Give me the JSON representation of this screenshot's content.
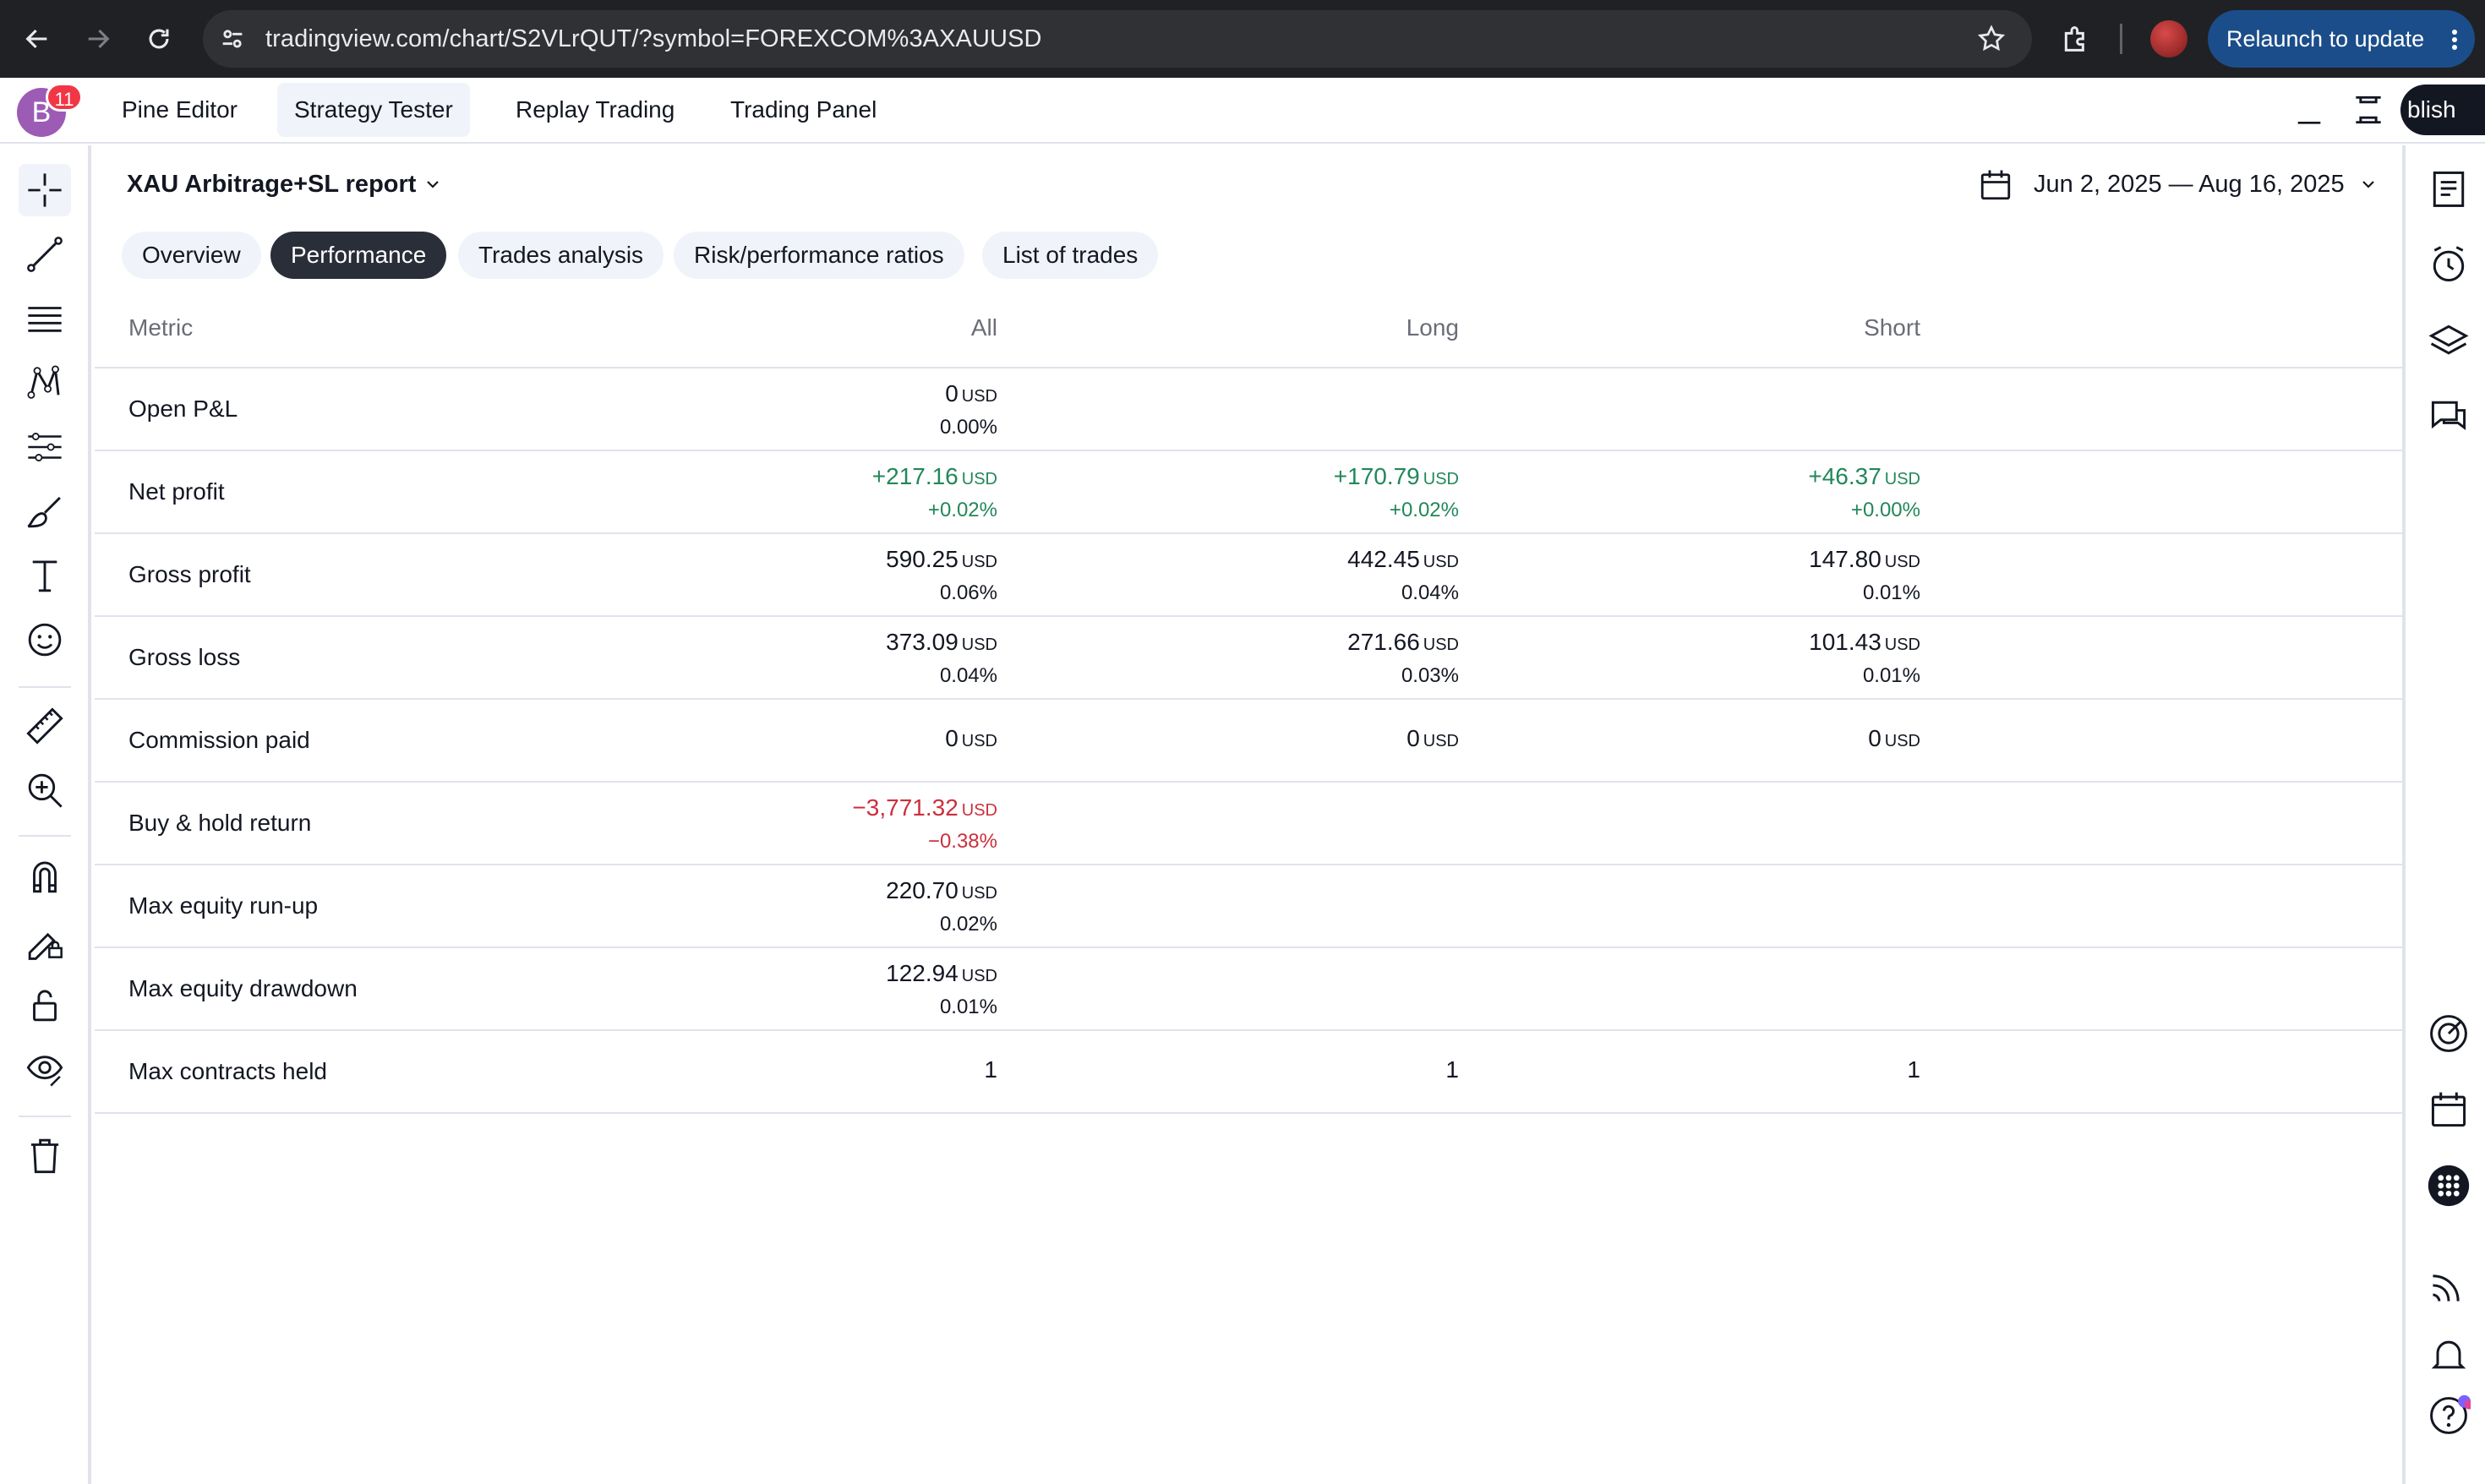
{
  "browser": {
    "url": "tradingview.com/chart/S2VLrQUT/?symbol=FOREXCOM%3AXAUUSD",
    "relaunch_label": "Relaunch to update"
  },
  "header": {
    "avatar_letter": "B",
    "notification_count": "11",
    "tabs": [
      {
        "label": "Pine Editor",
        "active": false
      },
      {
        "label": "Strategy Tester",
        "active": true
      },
      {
        "label": "Replay Trading",
        "active": false
      },
      {
        "label": "Trading Panel",
        "active": false
      }
    ],
    "publish_label": "blish"
  },
  "report": {
    "title": "XAU Arbitrage+SL report",
    "date_range": "Jun 2, 2025 — Aug 16, 2025",
    "tabs": [
      {
        "label": "Overview",
        "active": false
      },
      {
        "label": "Performance",
        "active": true
      },
      {
        "label": "Trades analysis",
        "active": false
      },
      {
        "label": "Risk/performance ratios",
        "active": false
      },
      {
        "label": "List of trades",
        "active": false
      }
    ],
    "columns": {
      "metric": "Metric",
      "all": "All",
      "long": "Long",
      "short": "Short"
    },
    "rows": [
      {
        "label": "Open P&L",
        "all": {
          "value": "0",
          "unit": "USD",
          "pct": "0.00%"
        },
        "long": {
          "value": "",
          "unit": "",
          "pct": ""
        },
        "short": {
          "value": "",
          "unit": "",
          "pct": ""
        }
      },
      {
        "label": "Net profit",
        "all": {
          "value": "+217.16",
          "unit": "USD",
          "pct": "+0.02%"
        },
        "long": {
          "value": "+170.79",
          "unit": "USD",
          "pct": "+0.02%"
        },
        "short": {
          "value": "+46.37",
          "unit": "USD",
          "pct": "+0.00%"
        }
      },
      {
        "label": "Gross profit",
        "all": {
          "value": "590.25",
          "unit": "USD",
          "pct": "0.06%"
        },
        "long": {
          "value": "442.45",
          "unit": "USD",
          "pct": "0.04%"
        },
        "short": {
          "value": "147.80",
          "unit": "USD",
          "pct": "0.01%"
        }
      },
      {
        "label": "Gross loss",
        "all": {
          "value": "373.09",
          "unit": "USD",
          "pct": "0.04%"
        },
        "long": {
          "value": "271.66",
          "unit": "USD",
          "pct": "0.03%"
        },
        "short": {
          "value": "101.43",
          "unit": "USD",
          "pct": "0.01%"
        }
      },
      {
        "label": "Commission paid",
        "all": {
          "value": "0",
          "unit": "USD",
          "pct": ""
        },
        "long": {
          "value": "0",
          "unit": "USD",
          "pct": ""
        },
        "short": {
          "value": "0",
          "unit": "USD",
          "pct": ""
        }
      },
      {
        "label": "Buy & hold return",
        "all": {
          "value": "−3,771.32",
          "unit": "USD",
          "pct": "−0.38%"
        },
        "long": {
          "value": "",
          "unit": "",
          "pct": ""
        },
        "short": {
          "value": "",
          "unit": "",
          "pct": ""
        }
      },
      {
        "label": "Max equity run-up",
        "all": {
          "value": "220.70",
          "unit": "USD",
          "pct": "0.02%"
        },
        "long": {
          "value": "",
          "unit": "",
          "pct": ""
        },
        "short": {
          "value": "",
          "unit": "",
          "pct": ""
        }
      },
      {
        "label": "Max equity drawdown",
        "all": {
          "value": "122.94",
          "unit": "USD",
          "pct": "0.01%"
        },
        "long": {
          "value": "",
          "unit": "",
          "pct": ""
        },
        "short": {
          "value": "",
          "unit": "",
          "pct": ""
        }
      },
      {
        "label": "Max contracts held",
        "all": {
          "value": "1",
          "unit": "",
          "pct": ""
        },
        "long": {
          "value": "1",
          "unit": "",
          "pct": ""
        },
        "short": {
          "value": "1",
          "unit": "",
          "pct": ""
        }
      }
    ]
  },
  "colors": {
    "positive": "#22875a",
    "negative": "#cc2f3c",
    "active_tab": "#2a2e39",
    "relaunch": "#1b4d8a"
  },
  "icons": {
    "left_toolbar": [
      "crosshair-icon",
      "trendline-icon",
      "fib-icon",
      "pattern-icon",
      "prediction-icon",
      "brush-icon",
      "text-icon",
      "emoji-icon",
      "ruler-icon",
      "zoom-in-icon",
      "magnet-icon",
      "lock-drawing-icon",
      "unlock-icon",
      "eye-icon",
      "trash-icon"
    ],
    "right_toolbar": [
      "watchlist-icon",
      "alerts-icon",
      "layers-icon",
      "chat-icon",
      "target-icon",
      "calendar-icon",
      "apps-icon",
      "stream-icon",
      "bell-icon",
      "help-icon"
    ]
  }
}
